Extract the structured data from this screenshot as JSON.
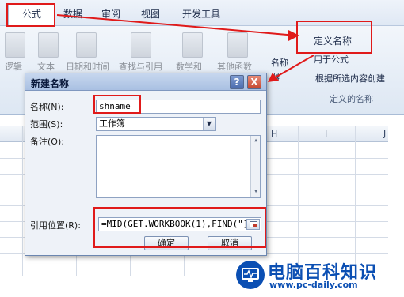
{
  "ribbon_tabs": [
    "公式",
    "数据",
    "审阅",
    "视图",
    "开发工具"
  ],
  "ribbon_groups": [
    "逻辑",
    "文本",
    "日期和时间",
    "查找与引用",
    "数学和",
    "其他函数"
  ],
  "defined_names": {
    "define_name": "定义名称",
    "name_manager_top": "名称",
    "name_manager_bottom": "器",
    "use_in_formula": "用于公式",
    "create_from_selection": "根据所选内容创建",
    "group_label": "定义的名称"
  },
  "columns": [
    "H",
    "I",
    "J"
  ],
  "dialog": {
    "title": "新建名称",
    "help": "?",
    "close": "X",
    "name_label": "名称(N):",
    "name_value": "shname",
    "scope_label": "范围(S):",
    "scope_value": "工作簿",
    "comment_label": "备注(O):",
    "ref_label": "引用位置(R):",
    "ref_value": "=MID(GET.WORKBOOK(1),FIND(\"]\",",
    "ok": "确定",
    "cancel": "取消"
  },
  "watermark": {
    "title": "电脑百科知识",
    "url": "www.pc-daily.com"
  },
  "colors": {
    "annotation": "#e01a1a",
    "brand": "#0b4fb3"
  }
}
